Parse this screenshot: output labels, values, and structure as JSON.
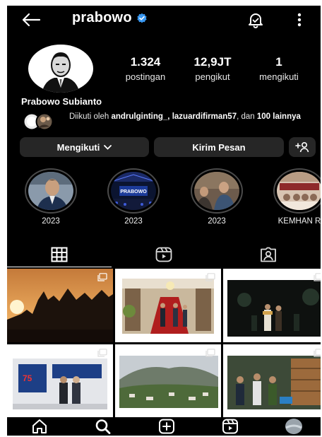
{
  "header": {
    "username": "prabowo",
    "verified": true
  },
  "profile": {
    "full_name": "Prabowo Subianto",
    "stats": [
      {
        "value": "1.324",
        "label": "postingan"
      },
      {
        "value": "12,9JT",
        "label": "pengikut"
      },
      {
        "value": "1",
        "label": "mengikuti"
      }
    ],
    "mutual": {
      "prefix": "Diikuti oleh ",
      "names": "andrulginting_, lazuardifirman57",
      "middle": ", dan ",
      "others": "100 lainnya"
    }
  },
  "actions": {
    "follow_label": "Mengikuti",
    "message_label": "Kirim Pesan"
  },
  "highlights": [
    {
      "label": "2023"
    },
    {
      "label": "2023",
      "banner_text": "PRABOWO"
    },
    {
      "label": "2023"
    },
    {
      "label": "KEMHAN R"
    }
  ],
  "colors": {
    "background": "#000000",
    "button": "#262626",
    "verified": "#3897f0",
    "text": "#ffffff"
  },
  "icons": {
    "back": "arrow-left-icon",
    "notifications": "bell-icon",
    "more": "more-vertical-icon",
    "grid": "grid-icon",
    "reels": "reels-icon",
    "tagged": "tagged-icon",
    "home": "home-icon",
    "search": "search-icon",
    "create": "plus-square-icon",
    "profile": "avatar"
  }
}
